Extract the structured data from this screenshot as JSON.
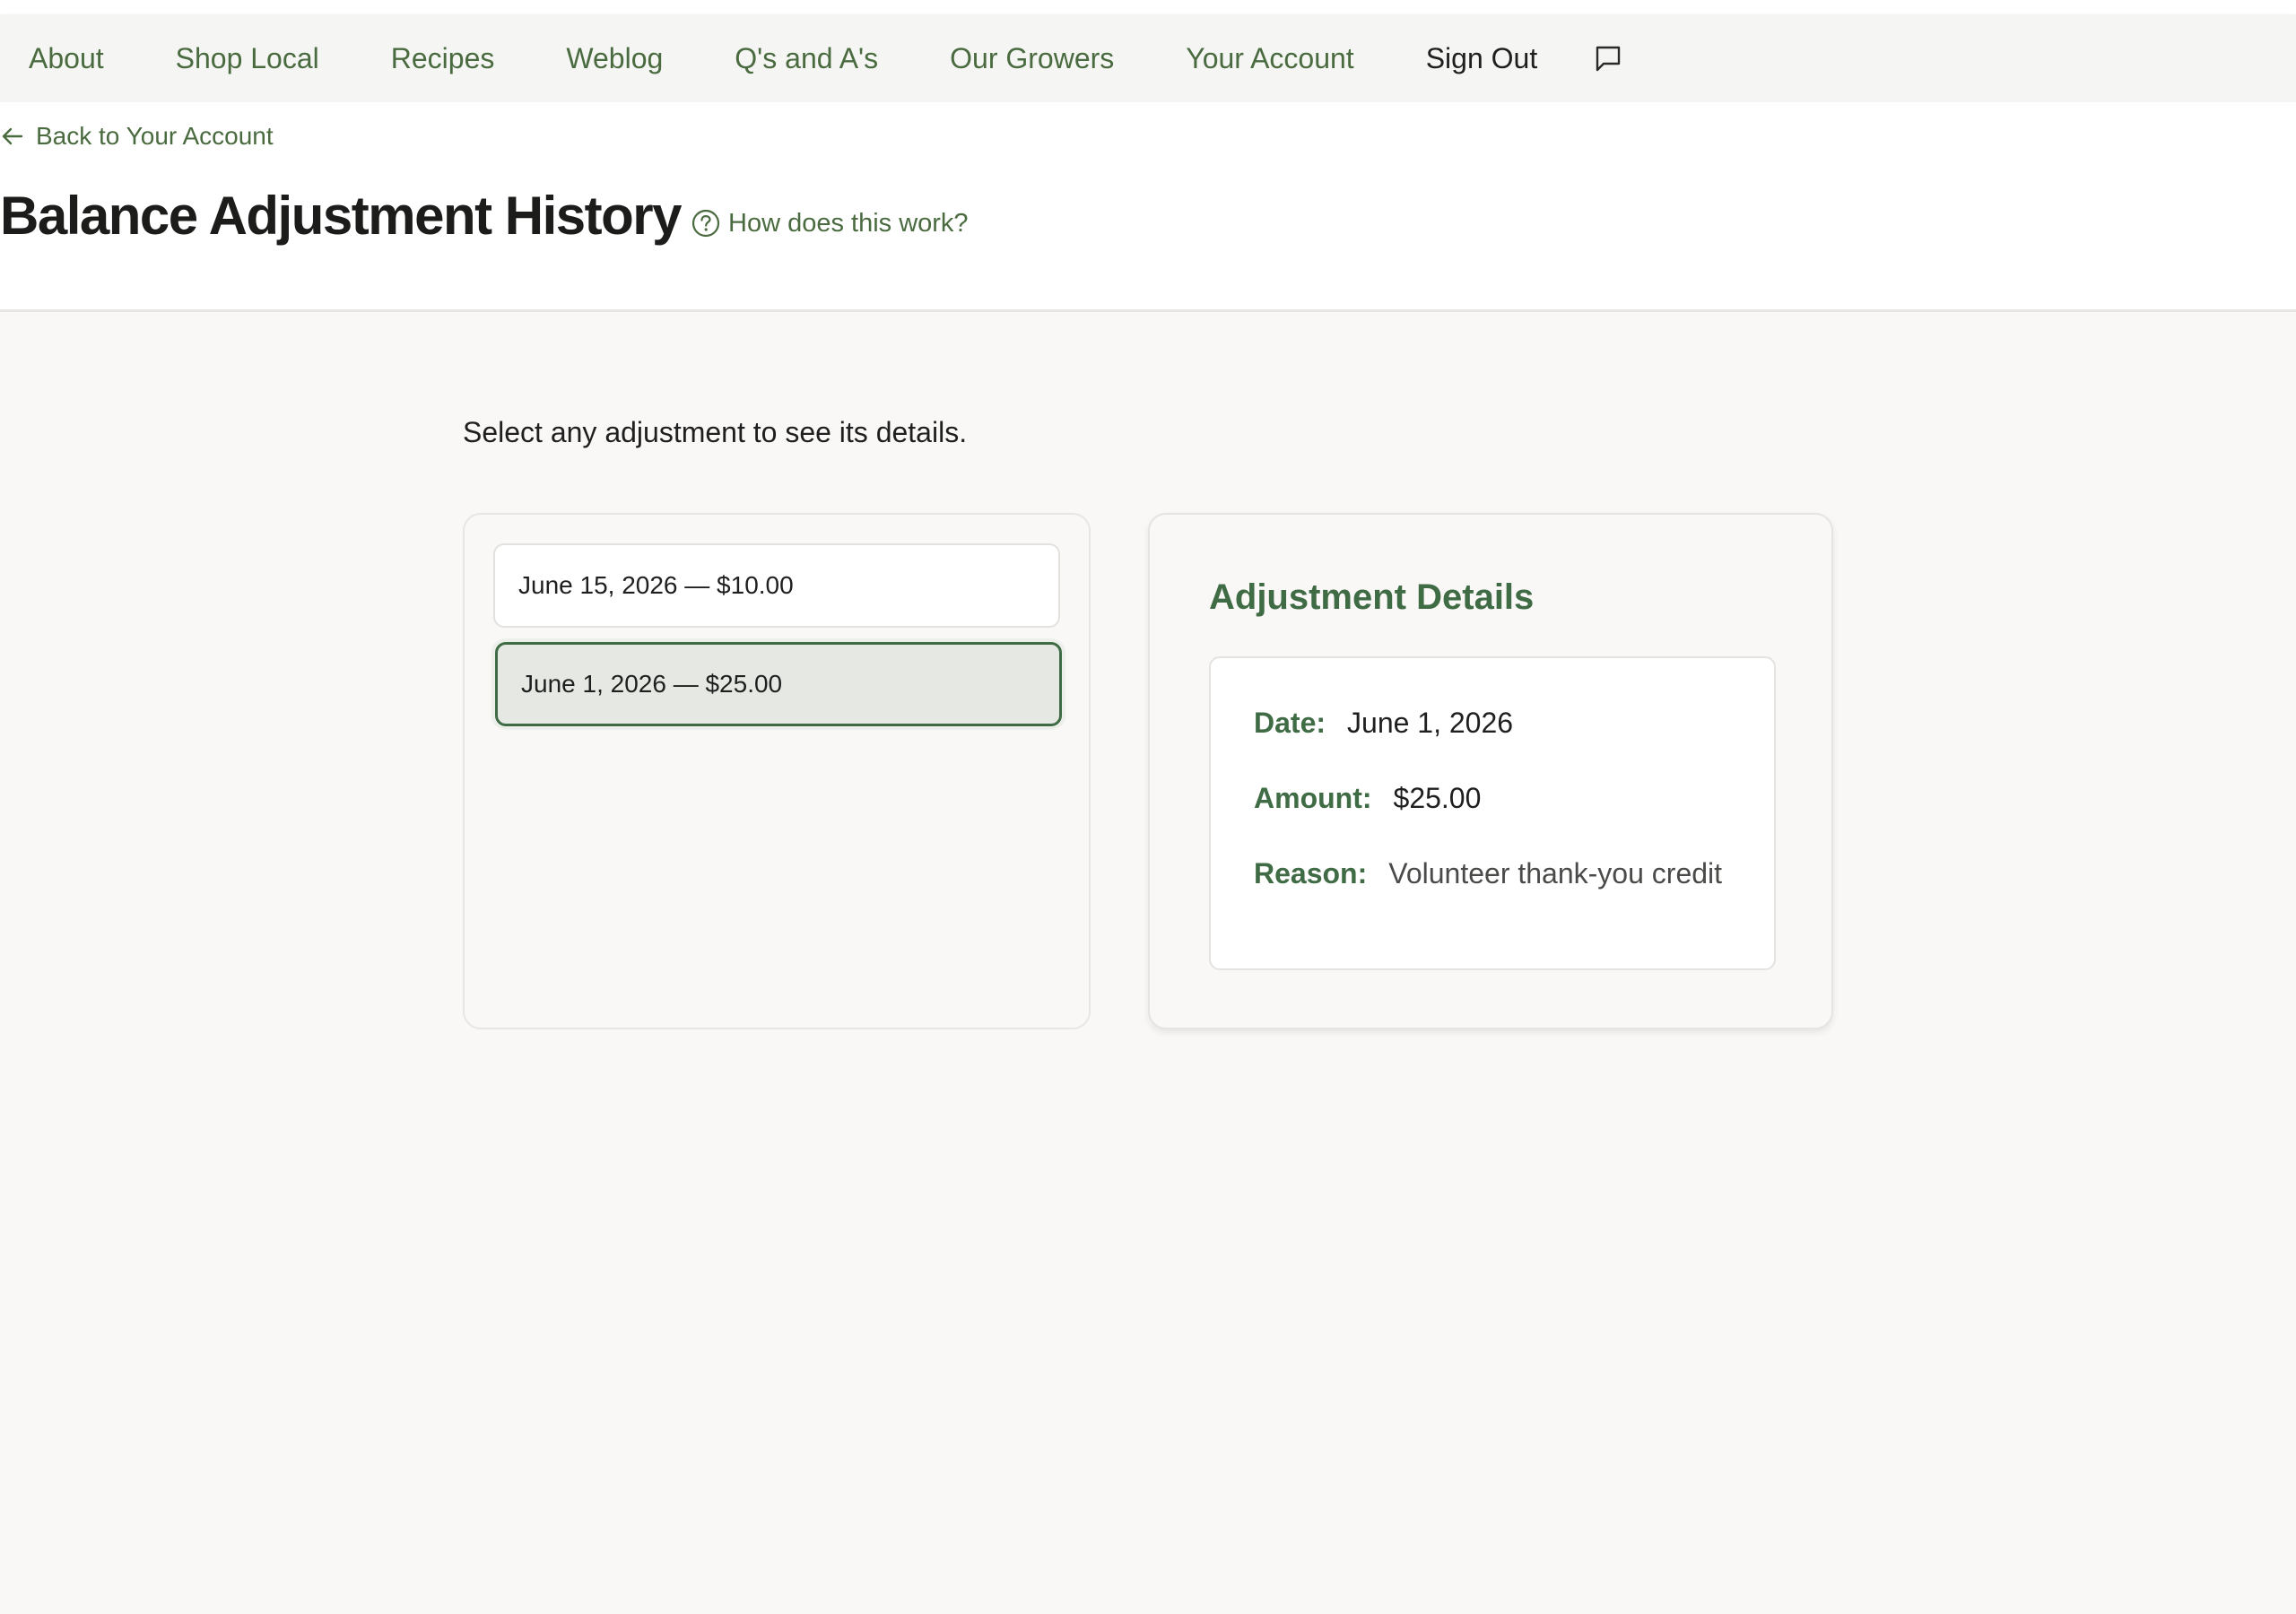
{
  "nav": {
    "items": [
      {
        "label": "About"
      },
      {
        "label": "Shop Local"
      },
      {
        "label": "Recipes"
      },
      {
        "label": "Weblog"
      },
      {
        "label": "Q's and A's"
      },
      {
        "label": "Our Growers"
      },
      {
        "label": "Your Account"
      }
    ],
    "sign_out": "Sign Out",
    "chat_icon": "chat-bubble-icon"
  },
  "header": {
    "back_link": "Back to Your Account",
    "title": "Balance Adjustment History",
    "help_link": "How does this work?"
  },
  "main": {
    "instructions": "Select any adjustment to see its details.",
    "adjustments": [
      {
        "label": "June 15, 2026 — $10.00",
        "selected": false
      },
      {
        "label": "June 1, 2026 — $25.00",
        "selected": true
      }
    ],
    "details": {
      "title": "Adjustment Details",
      "date_label": "Date:",
      "date_value": "June 1, 2026",
      "amount_label": "Amount:",
      "amount_value": "$25.00",
      "reason_label": "Reason:",
      "reason_value": "Volunteer thank-you credit"
    }
  },
  "colors": {
    "accent_green": "#4a6b3f",
    "heading_green": "#3f6b45",
    "selected_bg": "#e6e9e3",
    "page_bg": "#f9f8f7"
  }
}
